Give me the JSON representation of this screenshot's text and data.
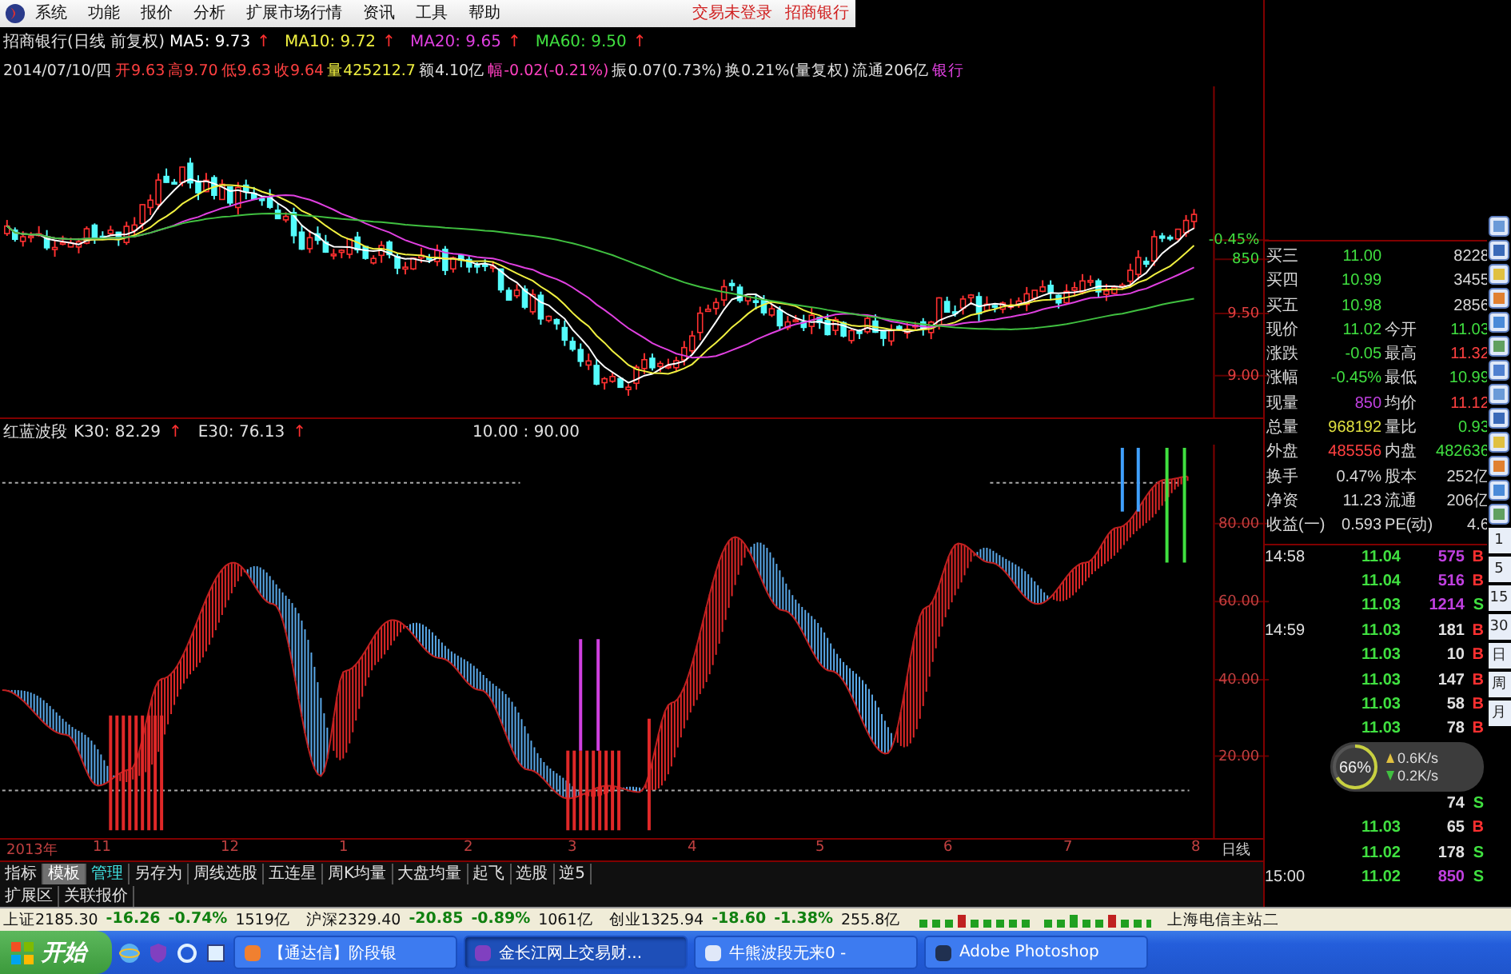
{
  "menu": {
    "items": [
      "系统",
      "功能",
      "报价",
      "分析",
      "扩展市场行情",
      "资讯",
      "工具",
      "帮助"
    ],
    "right": [
      "交易未登录",
      "招商银行"
    ]
  },
  "ma_line": [
    {
      "text": "招商银行(日线 前复权)",
      "color": "#e0e0e0"
    },
    {
      "text": "MA5: 9.73",
      "color": "#ffffff",
      "arrow": "↑"
    },
    {
      "text": "MA10: 9.72",
      "color": "#f0f040",
      "arrow": "↑"
    },
    {
      "text": "MA20: 9.65",
      "color": "#e040e0",
      "arrow": "↑"
    },
    {
      "text": "MA60: 9.50",
      "color": "#40e040",
      "arrow": "↑"
    }
  ],
  "bar_info": [
    {
      "text": "2014/07/10/四",
      "color": "#e0e0e0"
    },
    {
      "text": "开9.63",
      "color": "#ff4040"
    },
    {
      "text": "高9.70",
      "color": "#ff4040"
    },
    {
      "text": "低9.63",
      "color": "#ff4040"
    },
    {
      "text": "收9.64",
      "color": "#ff4040"
    },
    {
      "text": "量425212.7",
      "color": "#f0f040"
    },
    {
      "text": "额4.10亿",
      "color": "#e0e0e0"
    },
    {
      "text": "幅-0.02(-0.21%)",
      "color": "#ff40c0"
    },
    {
      "text": "振0.07(0.73%)",
      "color": "#e0e0e0"
    },
    {
      "text": "换0.21%(量复权)",
      "color": "#e0e0e0"
    },
    {
      "text": "流通206亿",
      "color": "#e0e0e0"
    },
    {
      "text": "银行",
      "color": "#e040e0"
    }
  ],
  "price_axis": [
    {
      "text": "-0.45%",
      "color": "#40e040"
    },
    {
      "text": "850",
      "color": "#40e040"
    },
    {
      "text": "9.50",
      "color": "#e04040"
    },
    {
      "text": "9.00",
      "color": "#e04040"
    }
  ],
  "indicator_header": [
    {
      "text": "红蓝波段",
      "color": "#e0e0e0"
    },
    {
      "text": "K30: 82.29",
      "color": "#e0e0e0",
      "arrow": "↑"
    },
    {
      "text": "E30: 76.13",
      "color": "#e0e0e0",
      "arrow": "↑"
    },
    {
      "text": "10.00 : 90.00",
      "color": "#e0e0e0"
    }
  ],
  "indicator_axis": [
    "80.00",
    "60.00",
    "40.00",
    "20.00"
  ],
  "time_axis": [
    "2013年",
    "11",
    "12",
    "1",
    "2",
    "3",
    "4",
    "5",
    "6",
    "7",
    "8"
  ],
  "period_label": "日线",
  "tabs": [
    {
      "label": "指标",
      "selected": false,
      "accent": false
    },
    {
      "label": "模板",
      "selected": true,
      "accent": false
    },
    {
      "label": "管理",
      "selected": false,
      "accent": true
    },
    {
      "label": "另存为",
      "selected": false,
      "accent": false
    },
    {
      "label": "周线选股",
      "selected": false,
      "accent": false
    },
    {
      "label": "五连星",
      "selected": false,
      "accent": false
    },
    {
      "label": "周K均量",
      "selected": false,
      "accent": false
    },
    {
      "label": "大盘均量",
      "selected": false,
      "accent": false
    },
    {
      "label": "起飞",
      "selected": false,
      "accent": false
    },
    {
      "label": "选股",
      "selected": false,
      "accent": false
    },
    {
      "label": "逆5",
      "selected": false,
      "accent": false
    }
  ],
  "extension_tabs": [
    "扩展区",
    "关联报价"
  ],
  "quote": [
    {
      "cells": [
        {
          "text": "买三",
          "color": "#d8d8d8"
        },
        {
          "text": "11.00",
          "color": "#40e040"
        },
        {
          "text": "8228",
          "color": "#d8d8d8"
        }
      ]
    },
    {
      "cells": [
        {
          "text": "买四",
          "color": "#d8d8d8"
        },
        {
          "text": "10.99",
          "color": "#40e040"
        },
        {
          "text": "3455",
          "color": "#d8d8d8"
        }
      ]
    },
    {
      "cells": [
        {
          "text": "买五",
          "color": "#d8d8d8"
        },
        {
          "text": "10.98",
          "color": "#40e040"
        },
        {
          "text": "2856",
          "color": "#d8d8d8"
        }
      ]
    },
    {
      "cells": [
        {
          "text": "现价",
          "color": "#d8d8d8"
        },
        {
          "text": "11.02",
          "color": "#40e040"
        },
        {
          "text": "今开",
          "color": "#d8d8d8"
        },
        {
          "text": "11.03",
          "color": "#40e040"
        }
      ]
    },
    {
      "cells": [
        {
          "text": "涨跌",
          "color": "#d8d8d8"
        },
        {
          "text": "-0.05",
          "color": "#40e040"
        },
        {
          "text": "最高",
          "color": "#d8d8d8"
        },
        {
          "text": "11.32",
          "color": "#ff4040"
        }
      ]
    },
    {
      "cells": [
        {
          "text": "涨幅",
          "color": "#d8d8d8"
        },
        {
          "text": "-0.45%",
          "color": "#40e040"
        },
        {
          "text": "最低",
          "color": "#d8d8d8"
        },
        {
          "text": "10.99",
          "color": "#40e040"
        }
      ]
    },
    {
      "cells": [
        {
          "text": "现量",
          "color": "#d8d8d8"
        },
        {
          "text": "850",
          "color": "#c040e0"
        },
        {
          "text": "均价",
          "color": "#d8d8d8"
        },
        {
          "text": "11.12",
          "color": "#ff4040"
        }
      ]
    },
    {
      "cells": [
        {
          "text": "总量",
          "color": "#d8d8d8"
        },
        {
          "text": "968192",
          "color": "#e0e040"
        },
        {
          "text": "量比",
          "color": "#d8d8d8"
        },
        {
          "text": "0.93",
          "color": "#40e040"
        }
      ]
    },
    {
      "cells": [
        {
          "text": "外盘",
          "color": "#d8d8d8"
        },
        {
          "text": "485556",
          "color": "#ff4040"
        },
        {
          "text": "内盘",
          "color": "#d8d8d8"
        },
        {
          "text": "482636",
          "color": "#40e040"
        }
      ]
    },
    {
      "cells": [
        {
          "text": "换手",
          "color": "#d8d8d8"
        },
        {
          "text": "0.47%",
          "color": "#d8d8d8"
        },
        {
          "text": "股本",
          "color": "#d8d8d8"
        },
        {
          "text": "252亿",
          "color": "#d8d8d8"
        }
      ]
    },
    {
      "cells": [
        {
          "text": "净资",
          "color": "#d8d8d8"
        },
        {
          "text": "11.23",
          "color": "#d8d8d8"
        },
        {
          "text": "流通",
          "color": "#d8d8d8"
        },
        {
          "text": "206亿",
          "color": "#d8d8d8"
        }
      ]
    },
    {
      "cells": [
        {
          "text": "收益(一)",
          "color": "#d8d8d8"
        },
        {
          "text": "0.593",
          "color": "#d8d8d8"
        },
        {
          "text": "PE(动)",
          "color": "#d8d8d8"
        },
        {
          "text": "4.6",
          "color": "#d8d8d8"
        }
      ]
    }
  ],
  "ticks": [
    {
      "time": "14:58",
      "price": "11.04",
      "volume": "575",
      "side": "B",
      "large": true
    },
    {
      "price": "11.04",
      "volume": "516",
      "side": "B",
      "large": true
    },
    {
      "price": "11.03",
      "volume": "1214",
      "side": "S",
      "large": true
    },
    {
      "time": "14:59",
      "price": "11.03",
      "volume": "181",
      "side": "B",
      "large": false
    },
    {
      "price": "11.03",
      "volume": "10",
      "side": "B",
      "large": false
    },
    {
      "price": "11.03",
      "volume": "147",
      "side": "B",
      "large": false
    },
    {
      "price": "11.03",
      "volume": "58",
      "side": "B",
      "large": false
    },
    {
      "price": "11.03",
      "volume": "78",
      "side": "B",
      "large": false
    },
    {
      "volume": "74",
      "side": "S",
      "large": false
    },
    {
      "price": "11.03",
      "volume": "65",
      "side": "B",
      "large": false
    },
    {
      "price": "11.02",
      "volume": "178",
      "side": "S",
      "large": false
    },
    {
      "time": "15:00",
      "price": "11.02",
      "volume": "850",
      "side": "S",
      "large": true
    }
  ],
  "gauge": {
    "percent": "66%",
    "level": 0.66,
    "upload": "0.6K/s",
    "download": "0.2K/s"
  },
  "period_buttons": [
    "1",
    "5",
    "15",
    "30",
    "日",
    "周",
    "月"
  ],
  "status_bar": {
    "indices": [
      {
        "name": "上证2185.30",
        "change": "-16.26",
        "pct": "-0.74%",
        "amount": "1519亿"
      },
      {
        "name": "沪深2329.40",
        "change": "-20.85",
        "pct": "-0.89%",
        "amount": "1061亿"
      },
      {
        "name": "创业1325.94",
        "change": "-18.60",
        "pct": "-1.38%",
        "amount": "255.8亿"
      }
    ],
    "server": "上海电信主站二"
  },
  "taskbar": {
    "start": "开始",
    "tasks": [
      {
        "label": "【通达信】阶段银",
        "selected": false
      },
      {
        "label": "金长江网上交易财...",
        "selected": true
      },
      {
        "label": "牛熊波段无来0 -",
        "selected": false
      },
      {
        "label": "Adobe Photoshop",
        "selected": false
      }
    ]
  }
}
